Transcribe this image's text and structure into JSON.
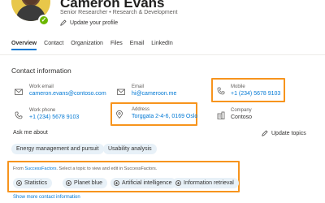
{
  "profile": {
    "name": "Cameron Evans",
    "subtitle": "Senior Researcher  •  Research & Development",
    "update_profile": "Update your profile"
  },
  "tabs": [
    {
      "label": "Overview",
      "active": true
    },
    {
      "label": "Contact"
    },
    {
      "label": "Organization"
    },
    {
      "label": "Files"
    },
    {
      "label": "Email"
    },
    {
      "label": "LinkedIn"
    }
  ],
  "contact": {
    "title": "Contact information",
    "work_email": {
      "label": "Work email",
      "value": "cameron.evans@contoso.com"
    },
    "email": {
      "label": "Email",
      "value": "hi@cameroon.me"
    },
    "mobile": {
      "label": "Mobile",
      "value": "+1 (234) 5678 9103"
    },
    "work_phone": {
      "label": "Work phone",
      "value": "+1 (234) 5678 9103"
    },
    "address": {
      "label": "Address",
      "value": "Torggata 2-4-6, 0169 Oslo"
    },
    "company": {
      "label": "Company",
      "value": "Contoso"
    }
  },
  "ask": {
    "title": "Ask me about",
    "update_topics": "Update topics",
    "topics": [
      "Energy management and pursuit",
      "Usability analysis"
    ]
  },
  "successfactors": {
    "note_prefix": "From ",
    "note_link": "SuccessFactors",
    "note_suffix": ". Select a topic to view and edit in SuccessFactors.",
    "topics": [
      "Statistics",
      "Planet blue",
      "Artificial intelligence",
      "Information retrieval"
    ]
  },
  "show_more": "Show more contact information",
  "colors": {
    "accent": "#0078d4",
    "highlight": "#f7941d",
    "pill": "#e8f1f8"
  }
}
